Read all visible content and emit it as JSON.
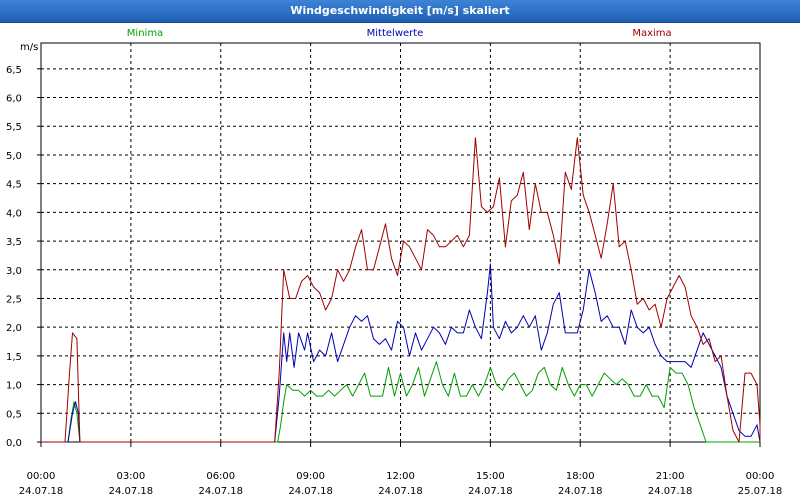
{
  "window": {
    "title": "Windgeschwindigkeit [m/s] skaliert"
  },
  "chart_data": {
    "type": "line",
    "title": "Windgeschwindigkeit [m/s] skaliert",
    "ylabel": "m/s",
    "ylim": [
      0,
      7
    ],
    "yticks": [
      "0,0",
      "0,5",
      "1,0",
      "1,5",
      "2,0",
      "2,5",
      "3,0",
      "3,5",
      "4,0",
      "4,5",
      "5,0",
      "5,5",
      "6,0",
      "6,5"
    ],
    "xlim": [
      0,
      24
    ],
    "xticks": [
      {
        "time": "00:00",
        "date": "24.07.18"
      },
      {
        "time": "03:00",
        "date": "24.07.18"
      },
      {
        "time": "06:00",
        "date": "24.07.18"
      },
      {
        "time": "09:00",
        "date": "24.07.18"
      },
      {
        "time": "12:00",
        "date": "24.07.18"
      },
      {
        "time": "15:00",
        "date": "24.07.18"
      },
      {
        "time": "18:00",
        "date": "24.07.18"
      },
      {
        "time": "21:00",
        "date": "24.07.18"
      },
      {
        "time": "00:00",
        "date": "25.07.18"
      }
    ],
    "grid": true,
    "series": [
      {
        "name": "Minima",
        "color": "#00a000",
        "points": [
          [
            0,
            0
          ],
          [
            0.9,
            0
          ],
          [
            1.0,
            0.4
          ],
          [
            1.1,
            0.7
          ],
          [
            1.2,
            0.5
          ],
          [
            1.3,
            0
          ],
          [
            7.9,
            0
          ],
          [
            8.0,
            0.3
          ],
          [
            8.1,
            0.7
          ],
          [
            8.2,
            1.0
          ],
          [
            8.4,
            0.9
          ],
          [
            8.6,
            0.9
          ],
          [
            8.8,
            0.8
          ],
          [
            9.0,
            0.9
          ],
          [
            9.2,
            0.8
          ],
          [
            9.4,
            0.8
          ],
          [
            9.6,
            0.9
          ],
          [
            9.8,
            0.8
          ],
          [
            10.0,
            0.9
          ],
          [
            10.2,
            1.0
          ],
          [
            10.4,
            0.8
          ],
          [
            10.6,
            1.0
          ],
          [
            10.8,
            1.2
          ],
          [
            11.0,
            0.8
          ],
          [
            11.2,
            0.8
          ],
          [
            11.4,
            0.8
          ],
          [
            11.6,
            1.3
          ],
          [
            11.8,
            0.8
          ],
          [
            12.0,
            1.2
          ],
          [
            12.2,
            0.8
          ],
          [
            12.4,
            1.0
          ],
          [
            12.6,
            1.3
          ],
          [
            12.8,
            0.8
          ],
          [
            13.0,
            1.1
          ],
          [
            13.2,
            1.4
          ],
          [
            13.4,
            1.0
          ],
          [
            13.6,
            0.8
          ],
          [
            13.8,
            1.2
          ],
          [
            14.0,
            0.8
          ],
          [
            14.2,
            0.8
          ],
          [
            14.4,
            1.0
          ],
          [
            14.6,
            0.8
          ],
          [
            14.8,
            1.0
          ],
          [
            15.0,
            1.3
          ],
          [
            15.2,
            1.0
          ],
          [
            15.4,
            0.9
          ],
          [
            15.6,
            1.1
          ],
          [
            15.8,
            1.2
          ],
          [
            16.0,
            1.0
          ],
          [
            16.2,
            0.8
          ],
          [
            16.4,
            0.9
          ],
          [
            16.6,
            1.2
          ],
          [
            16.8,
            1.3
          ],
          [
            17.0,
            1.0
          ],
          [
            17.2,
            0.9
          ],
          [
            17.4,
            1.3
          ],
          [
            17.6,
            1.0
          ],
          [
            17.8,
            0.8
          ],
          [
            18.0,
            1.0
          ],
          [
            18.2,
            1.0
          ],
          [
            18.4,
            0.8
          ],
          [
            18.6,
            1.0
          ],
          [
            18.8,
            1.2
          ],
          [
            19.0,
            1.1
          ],
          [
            19.2,
            1.0
          ],
          [
            19.4,
            1.1
          ],
          [
            19.6,
            1.0
          ],
          [
            19.8,
            0.8
          ],
          [
            20.0,
            0.8
          ],
          [
            20.2,
            1.0
          ],
          [
            20.4,
            0.8
          ],
          [
            20.6,
            0.8
          ],
          [
            20.8,
            0.6
          ],
          [
            21.0,
            1.3
          ],
          [
            21.2,
            1.2
          ],
          [
            21.4,
            1.2
          ],
          [
            21.6,
            1.0
          ],
          [
            21.8,
            0.6
          ],
          [
            22.0,
            0.3
          ],
          [
            22.2,
            0
          ],
          [
            24,
            0
          ]
        ]
      },
      {
        "name": "Mittelwerte",
        "color": "#0000b0",
        "points": [
          [
            0,
            0
          ],
          [
            0.9,
            0
          ],
          [
            1.05,
            0.5
          ],
          [
            1.15,
            0.7
          ],
          [
            1.25,
            0.5
          ],
          [
            1.3,
            0
          ],
          [
            7.8,
            0
          ],
          [
            7.95,
            0.8
          ],
          [
            8.1,
            1.9
          ],
          [
            8.2,
            1.4
          ],
          [
            8.3,
            1.9
          ],
          [
            8.45,
            1.3
          ],
          [
            8.6,
            1.9
          ],
          [
            8.8,
            1.6
          ],
          [
            8.9,
            1.9
          ],
          [
            9.1,
            1.4
          ],
          [
            9.3,
            1.6
          ],
          [
            9.5,
            1.5
          ],
          [
            9.7,
            1.9
          ],
          [
            9.9,
            1.4
          ],
          [
            10.1,
            1.7
          ],
          [
            10.3,
            2.0
          ],
          [
            10.5,
            2.2
          ],
          [
            10.7,
            2.1
          ],
          [
            10.9,
            2.2
          ],
          [
            11.1,
            1.8
          ],
          [
            11.3,
            1.7
          ],
          [
            11.5,
            1.8
          ],
          [
            11.7,
            1.6
          ],
          [
            11.9,
            2.1
          ],
          [
            12.1,
            2.0
          ],
          [
            12.3,
            1.5
          ],
          [
            12.5,
            1.9
          ],
          [
            12.7,
            1.6
          ],
          [
            12.9,
            1.8
          ],
          [
            13.1,
            2.0
          ],
          [
            13.3,
            1.9
          ],
          [
            13.5,
            1.7
          ],
          [
            13.7,
            2.0
          ],
          [
            13.9,
            1.9
          ],
          [
            14.1,
            1.9
          ],
          [
            14.3,
            2.3
          ],
          [
            14.5,
            2.0
          ],
          [
            14.7,
            1.8
          ],
          [
            14.9,
            2.6
          ],
          [
            15.0,
            3.1
          ],
          [
            15.1,
            2.0
          ],
          [
            15.3,
            1.8
          ],
          [
            15.5,
            2.1
          ],
          [
            15.7,
            1.9
          ],
          [
            15.9,
            2.0
          ],
          [
            16.1,
            2.2
          ],
          [
            16.3,
            2.0
          ],
          [
            16.5,
            2.2
          ],
          [
            16.7,
            1.6
          ],
          [
            16.9,
            1.9
          ],
          [
            17.1,
            2.4
          ],
          [
            17.3,
            2.6
          ],
          [
            17.5,
            1.9
          ],
          [
            17.7,
            1.9
          ],
          [
            17.9,
            1.9
          ],
          [
            18.1,
            2.3
          ],
          [
            18.3,
            3.0
          ],
          [
            18.5,
            2.6
          ],
          [
            18.7,
            2.1
          ],
          [
            18.9,
            2.2
          ],
          [
            19.1,
            2.0
          ],
          [
            19.3,
            2.0
          ],
          [
            19.5,
            1.7
          ],
          [
            19.7,
            2.3
          ],
          [
            19.9,
            2.0
          ],
          [
            20.1,
            1.9
          ],
          [
            20.3,
            2.0
          ],
          [
            20.5,
            1.7
          ],
          [
            20.7,
            1.5
          ],
          [
            20.9,
            1.4
          ],
          [
            21.1,
            1.4
          ],
          [
            21.3,
            1.4
          ],
          [
            21.5,
            1.4
          ],
          [
            21.7,
            1.3
          ],
          [
            21.9,
            1.6
          ],
          [
            22.1,
            1.9
          ],
          [
            22.3,
            1.7
          ],
          [
            22.5,
            1.5
          ],
          [
            22.7,
            1.3
          ],
          [
            22.9,
            0.8
          ],
          [
            23.1,
            0.5
          ],
          [
            23.3,
            0.2
          ],
          [
            23.5,
            0.1
          ],
          [
            23.7,
            0.1
          ],
          [
            23.9,
            0.3
          ],
          [
            24.1,
            0
          ],
          [
            24.3,
            0
          ],
          [
            25.0,
            0
          ]
        ]
      },
      {
        "name": "Maxima",
        "color": "#a00000",
        "points": [
          [
            0,
            0
          ],
          [
            0.8,
            0
          ],
          [
            0.95,
            1.2
          ],
          [
            1.05,
            1.9
          ],
          [
            1.2,
            1.8
          ],
          [
            1.3,
            0
          ],
          [
            7.8,
            0
          ],
          [
            7.95,
            1.2
          ],
          [
            8.1,
            3.0
          ],
          [
            8.3,
            2.5
          ],
          [
            8.5,
            2.5
          ],
          [
            8.7,
            2.8
          ],
          [
            8.9,
            2.9
          ],
          [
            9.1,
            2.7
          ],
          [
            9.3,
            2.6
          ],
          [
            9.5,
            2.3
          ],
          [
            9.7,
            2.5
          ],
          [
            9.9,
            3.0
          ],
          [
            10.1,
            2.8
          ],
          [
            10.3,
            3.0
          ],
          [
            10.5,
            3.4
          ],
          [
            10.7,
            3.7
          ],
          [
            10.9,
            3.0
          ],
          [
            11.1,
            3.0
          ],
          [
            11.3,
            3.4
          ],
          [
            11.5,
            3.8
          ],
          [
            11.7,
            3.2
          ],
          [
            11.9,
            2.9
          ],
          [
            12.1,
            3.5
          ],
          [
            12.3,
            3.4
          ],
          [
            12.5,
            3.2
          ],
          [
            12.7,
            3.0
          ],
          [
            12.9,
            3.7
          ],
          [
            13.1,
            3.6
          ],
          [
            13.3,
            3.4
          ],
          [
            13.5,
            3.4
          ],
          [
            13.7,
            3.5
          ],
          [
            13.9,
            3.6
          ],
          [
            14.1,
            3.4
          ],
          [
            14.3,
            3.6
          ],
          [
            14.5,
            5.3
          ],
          [
            14.7,
            4.1
          ],
          [
            14.9,
            4.0
          ],
          [
            15.1,
            4.1
          ],
          [
            15.3,
            4.6
          ],
          [
            15.5,
            3.4
          ],
          [
            15.7,
            4.2
          ],
          [
            15.9,
            4.3
          ],
          [
            16.1,
            4.7
          ],
          [
            16.3,
            3.7
          ],
          [
            16.5,
            4.5
          ],
          [
            16.7,
            4.0
          ],
          [
            16.9,
            4.0
          ],
          [
            17.1,
            3.6
          ],
          [
            17.3,
            3.1
          ],
          [
            17.5,
            4.7
          ],
          [
            17.7,
            4.4
          ],
          [
            17.9,
            5.3
          ],
          [
            18.1,
            4.3
          ],
          [
            18.3,
            4.0
          ],
          [
            18.5,
            3.6
          ],
          [
            18.7,
            3.2
          ],
          [
            18.9,
            3.8
          ],
          [
            19.1,
            4.5
          ],
          [
            19.3,
            3.4
          ],
          [
            19.5,
            3.5
          ],
          [
            19.7,
            3.0
          ],
          [
            19.9,
            2.4
          ],
          [
            20.1,
            2.5
          ],
          [
            20.3,
            2.3
          ],
          [
            20.5,
            2.4
          ],
          [
            20.7,
            2.0
          ],
          [
            20.9,
            2.5
          ],
          [
            21.1,
            2.7
          ],
          [
            21.3,
            2.9
          ],
          [
            21.5,
            2.7
          ],
          [
            21.7,
            2.2
          ],
          [
            21.9,
            2.0
          ],
          [
            22.1,
            1.7
          ],
          [
            22.3,
            1.8
          ],
          [
            22.5,
            1.4
          ],
          [
            22.7,
            1.5
          ],
          [
            22.9,
            0.8
          ],
          [
            23.1,
            0.2
          ],
          [
            23.3,
            0
          ],
          [
            23.5,
            1.2
          ],
          [
            23.7,
            1.2
          ],
          [
            23.9,
            1.0
          ],
          [
            24.1,
            0.3
          ],
          [
            24.3,
            0
          ],
          [
            25.0,
            0
          ]
        ]
      }
    ]
  }
}
